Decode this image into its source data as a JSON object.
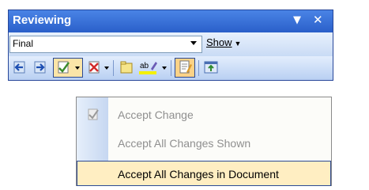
{
  "toolbar": {
    "title": "Reviewing",
    "display_value": "Final",
    "show_label": "Show"
  },
  "menu": {
    "items": [
      {
        "label": "Accept Change",
        "enabled": false
      },
      {
        "label": "Accept All Changes Shown",
        "enabled": false
      },
      {
        "label": "Accept All Changes in Document",
        "enabled": true,
        "highlighted": true
      }
    ]
  },
  "icons": {
    "previous": "previous-change-icon",
    "next": "next-change-icon",
    "accept": "accept-change-icon",
    "reject": "reject-change-icon",
    "comment": "new-comment-icon",
    "highlight": "highlight-icon",
    "track": "track-changes-icon",
    "pane": "reviewing-pane-icon"
  },
  "colors": {
    "titlebar": "#2a5fc9",
    "menu_highlight": "#ffeec2"
  }
}
